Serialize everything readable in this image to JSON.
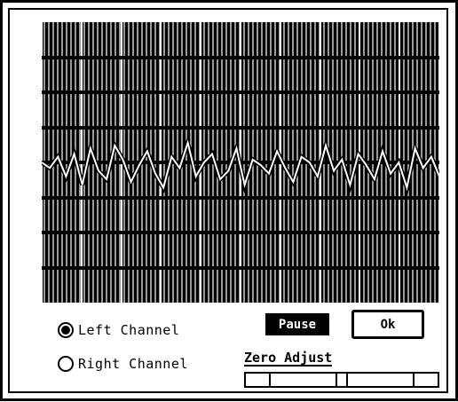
{
  "scope": {
    "background": "#000000",
    "foreground": "#ffffff",
    "waveform": [
      0.5,
      0.52,
      0.48,
      0.55,
      0.47,
      0.58,
      0.45,
      0.53,
      0.56,
      0.44,
      0.49,
      0.57,
      0.51,
      0.46,
      0.54,
      0.59,
      0.48,
      0.52,
      0.43,
      0.55,
      0.5,
      0.47,
      0.56,
      0.53,
      0.45,
      0.58,
      0.49,
      0.51,
      0.54,
      0.46,
      0.52,
      0.57,
      0.48,
      0.5,
      0.55,
      0.44,
      0.53,
      0.49,
      0.58,
      0.47,
      0.51,
      0.56,
      0.46,
      0.54,
      0.5,
      0.59,
      0.45,
      0.52,
      0.48,
      0.55
    ]
  },
  "channels": [
    {
      "label": "Left Channel",
      "selected": true
    },
    {
      "label": "Right Channel",
      "selected": false
    }
  ],
  "buttons": {
    "pause_label": "Pause",
    "ok_label": "Ok"
  },
  "zero_adjust": {
    "label": "Zero Adjust",
    "value": 0.5
  }
}
